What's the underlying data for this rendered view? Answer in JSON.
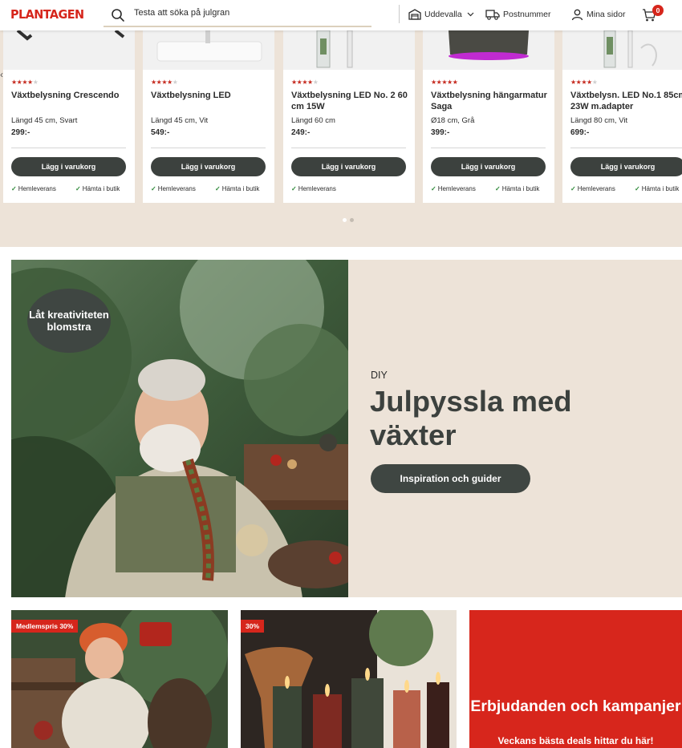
{
  "header": {
    "logo": "PLANTAGEN",
    "search_placeholder": "Testa att söka på julgran",
    "store": "Uddevalla",
    "postal": "Postnummer",
    "account": "Mina sidor",
    "cart_count": "0"
  },
  "carousel": {
    "products": [
      {
        "name": "Växtbelysning Crescendo",
        "spec": "Längd 45 cm, Svart",
        "price": "299:-",
        "rating": 4.5,
        "button": "Lägg i varukorg",
        "delivery": [
          "Hemleverans",
          "Hämta i butik"
        ]
      },
      {
        "name": "Växtbelysning LED",
        "spec": "Längd 45 cm, Vit",
        "price": "549:-",
        "rating": 4.5,
        "button": "Lägg i varukorg",
        "delivery": [
          "Hemleverans",
          "Hämta i butik"
        ]
      },
      {
        "name": "Växtbelysning LED No. 2 60 cm 15W",
        "spec": "Längd 60 cm",
        "price": "249:-",
        "rating": 4,
        "button": "Lägg i varukorg",
        "delivery": [
          "Hemleverans"
        ]
      },
      {
        "name": "Växtbelysning hängarmatur Saga",
        "spec": "Ø18 cm, Grå",
        "price": "399:-",
        "rating": 5,
        "button": "Lägg i varukorg",
        "delivery": [
          "Hemleverans",
          "Hämta i butik"
        ]
      },
      {
        "name": "Växtbelysn. LED No.1 85cm 23W m.adapter",
        "spec": "Längd 80 cm, Vit",
        "price": "699:-",
        "rating": 4.5,
        "button": "Lägg i varukorg",
        "delivery": [
          "Hemleverans",
          "Hämta i butik"
        ]
      }
    ],
    "pages": 2,
    "active_page": 1
  },
  "hero": {
    "badge": "Låt kreativiteten blomstra",
    "kicker": "DIY",
    "title": "Julpyssla med växter",
    "button": "Inspiration och guider"
  },
  "tiles": [
    {
      "tag": "Medlemspris 30%"
    },
    {
      "tag": "30%"
    },
    {
      "title": "Erbjudanden och kampanjer",
      "subtitle": "Veckans bästa deals hittar du här!"
    }
  ],
  "colors": {
    "brand_red": "#d6261c",
    "dark_button": "#3c413e",
    "beige_bg": "#ede3d8",
    "star": "#c62a1f",
    "check": "#2f8a3a"
  }
}
